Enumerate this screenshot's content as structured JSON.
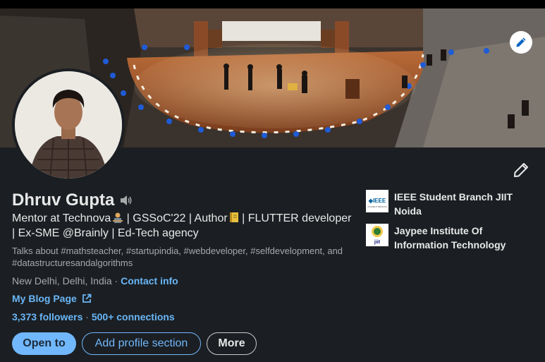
{
  "profile": {
    "name": "Dhruv Gupta",
    "headline_1": "Mentor at Technova",
    "headline_2": " | GSSoC'22 | Author",
    "headline_3": " | FLUTTER developer | Ex-SME @Brainly | Ed-Tech agency",
    "talks_about": "Talks about #mathsteacher, #startupindia, #webdeveloper, #selfdevelopment, and #datastructuresandalgorithms",
    "location": "New Delhi, Delhi, India",
    "location_separator": " · ",
    "contact_info": "Contact info",
    "blog_link": "My Blog Page",
    "followers": "3,373 followers",
    "connections_separator": " · ",
    "connections": "500+ connections"
  },
  "actions": {
    "open_to": "Open to",
    "add_section": "Add profile section",
    "more": "More"
  },
  "organizations": [
    {
      "name": "IEEE Student Branch JIIT Noida",
      "logo_text": "IEEE"
    },
    {
      "name": "Jaypee Institute Of Information Technology",
      "logo_text": "JIIT"
    }
  ],
  "colors": {
    "background": "#1b1f23",
    "accent": "#71b7fb",
    "link": "#6ab6f7"
  },
  "icons": {
    "cover_edit": "pencil-icon",
    "intro_edit": "pencil-icon",
    "pronunciation": "speaker-icon",
    "external_link": "external-link-icon"
  }
}
